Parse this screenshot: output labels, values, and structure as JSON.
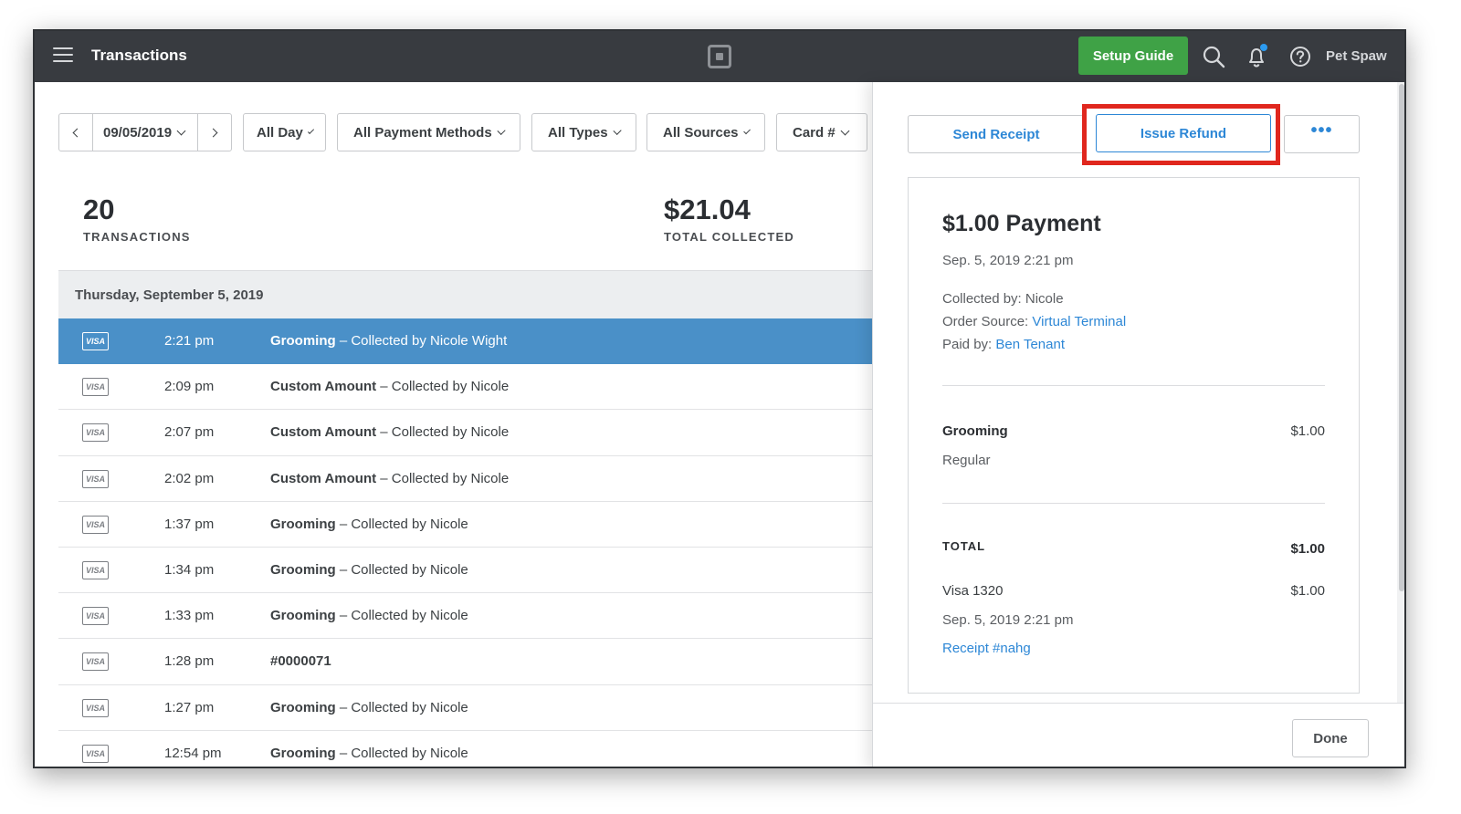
{
  "header": {
    "title": "Transactions",
    "setup_guide": "Setup Guide",
    "account": "Pet Spaw"
  },
  "filters": {
    "date": "09/05/2019",
    "time": "All Day",
    "payment_methods": "All Payment Methods",
    "types": "All Types",
    "sources": "All Sources",
    "card": "Card #"
  },
  "summary": {
    "transactions_count": "20",
    "transactions_label": "TRANSACTIONS",
    "total": "$21.04",
    "total_label": "TOTAL COLLECTED"
  },
  "list": {
    "date_header": "Thursday, September 5, 2019",
    "rows": [
      {
        "card": "VISA",
        "time": "2:21 pm",
        "item": "Grooming",
        "rest": " – Collected by Nicole Wight"
      },
      {
        "card": "VISA",
        "time": "2:09 pm",
        "item": "Custom Amount",
        "rest": " – Collected by Nicole"
      },
      {
        "card": "VISA",
        "time": "2:07 pm",
        "item": "Custom Amount",
        "rest": " – Collected by Nicole"
      },
      {
        "card": "VISA",
        "time": "2:02 pm",
        "item": "Custom Amount",
        "rest": " – Collected by Nicole"
      },
      {
        "card": "VISA",
        "time": "1:37 pm",
        "item": "Grooming",
        "rest": " – Collected by Nicole"
      },
      {
        "card": "VISA",
        "time": "1:34 pm",
        "item": "Grooming",
        "rest": " – Collected by Nicole"
      },
      {
        "card": "VISA",
        "time": "1:33 pm",
        "item": "Grooming",
        "rest": " – Collected by Nicole"
      },
      {
        "card": "VISA",
        "time": "1:28 pm",
        "item": "#0000071",
        "rest": ""
      },
      {
        "card": "VISA",
        "time": "1:27 pm",
        "item": "Grooming",
        "rest": " – Collected by Nicole"
      },
      {
        "card": "VISA",
        "time": "12:54 pm",
        "item": "Grooming",
        "rest": " – Collected by Nicole"
      }
    ]
  },
  "detail": {
    "send_receipt": "Send Receipt",
    "issue_refund": "Issue Refund",
    "more": "•••",
    "title": "$1.00 Payment",
    "datetime": "Sep. 5, 2019 2:21 pm",
    "collected_by": "Collected by: Nicole",
    "order_source_label": "Order Source: ",
    "order_source": "Virtual Terminal",
    "paid_by_label": "Paid by: ",
    "paid_by": "Ben Tenant",
    "item_name": "Grooming",
    "item_price": "$1.00",
    "item_variant": "Regular",
    "total_label": "TOTAL",
    "total_value": "$1.00",
    "card": "Visa 1320",
    "card_amount": "$1.00",
    "card_datetime": "Sep. 5, 2019 2:21 pm",
    "receipt": "Receipt #nahg",
    "done": "Done"
  },
  "colors": {
    "topbar": "#383b40",
    "setup_green": "#3fa246",
    "selected_row": "#4a90c8",
    "link_blue": "#2d87d6",
    "highlight_red": "#e0271e"
  }
}
